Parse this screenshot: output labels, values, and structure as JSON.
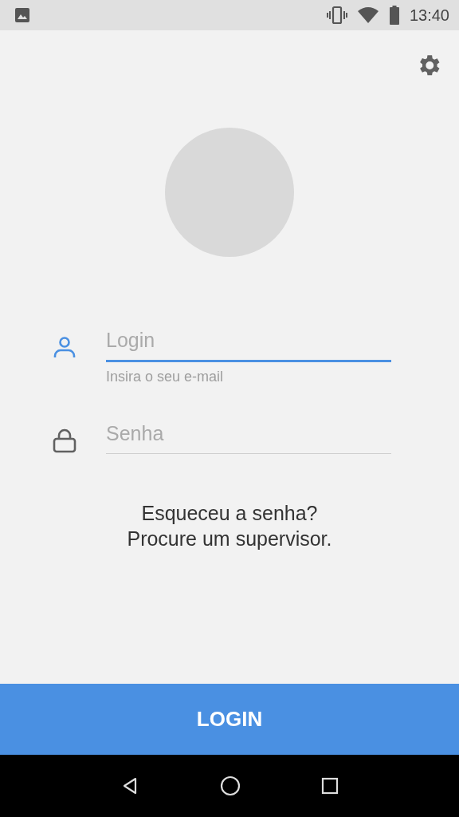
{
  "status_bar": {
    "time": "13:40"
  },
  "fields": [
    {
      "kind": "user",
      "placeholder": "Login",
      "focused": true,
      "helper": "Insira o seu e-mail"
    },
    {
      "kind": "lock",
      "placeholder": "Senha",
      "focused": false
    }
  ],
  "forgot_password": "Esqueceu a senha?\nProcure um supervisor.",
  "button": {
    "label": "LOGIN"
  }
}
